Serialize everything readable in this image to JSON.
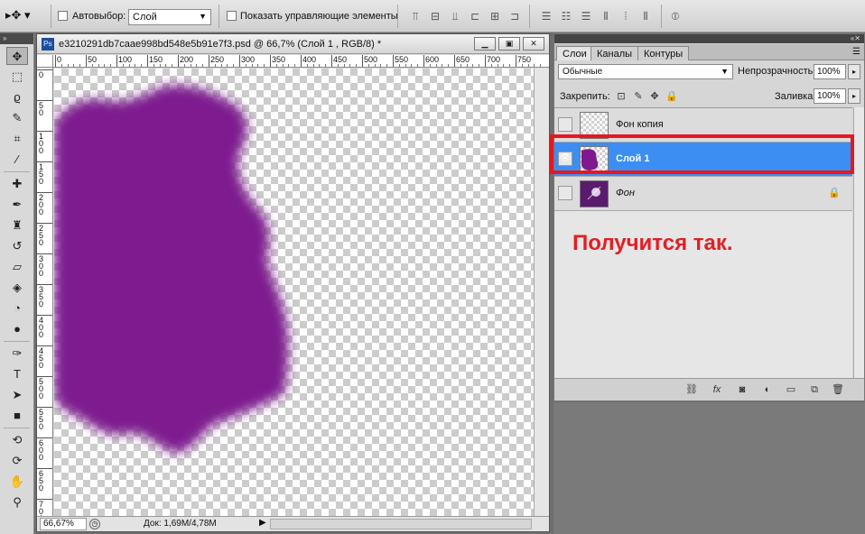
{
  "options_bar": {
    "auto_select_label": "Автовыбор:",
    "auto_select_value": "Слой",
    "show_controls_label": "Показать управляющие элементы"
  },
  "document": {
    "title": "e3210291db7caae998bd548e5b91e7f3.psd @ 66,7% (Слой 1 , RGB/8) *",
    "ps_icon": "Ps",
    "ruler_top": [
      "0",
      "50",
      "100",
      "150",
      "200",
      "250",
      "300",
      "350",
      "400",
      "450",
      "500",
      "550",
      "600",
      "650",
      "700",
      "750"
    ],
    "ruler_left": [
      "0",
      "5\n0",
      "1\n0\n0",
      "1\n5\n0",
      "2\n0\n0",
      "2\n5\n0",
      "3\n0\n0",
      "3\n5\n0",
      "4\n0\n0",
      "4\n5\n0",
      "5\n0\n0",
      "5\n5\n0",
      "6\n0\n0",
      "6\n5\n0",
      "7\n0\n0"
    ],
    "zoom": "66,67%",
    "doc_info": "Док: 1,69M/4,78M",
    "blob_color": "#7e1a8f"
  },
  "layers_panel": {
    "tabs": [
      "Слои",
      "Каналы",
      "Контуры"
    ],
    "blend_mode": "Обычные",
    "opacity_label": "Непрозрачность:",
    "opacity_value": "100%",
    "lock_label": "Закрепить:",
    "fill_label": "Заливка:",
    "fill_value": "100%",
    "layers": [
      {
        "name": "Фон копия",
        "visible": false,
        "selected": false,
        "locked": false
      },
      {
        "name": "Слой 1",
        "visible": true,
        "selected": true,
        "locked": false
      },
      {
        "name": "Фон",
        "visible": false,
        "selected": false,
        "locked": true
      }
    ]
  },
  "annotation": {
    "caption": "Получится так.",
    "color": "#e31e24"
  },
  "colors": {
    "selection": "#3c8ef3",
    "highlight_border": "#e8161f"
  }
}
